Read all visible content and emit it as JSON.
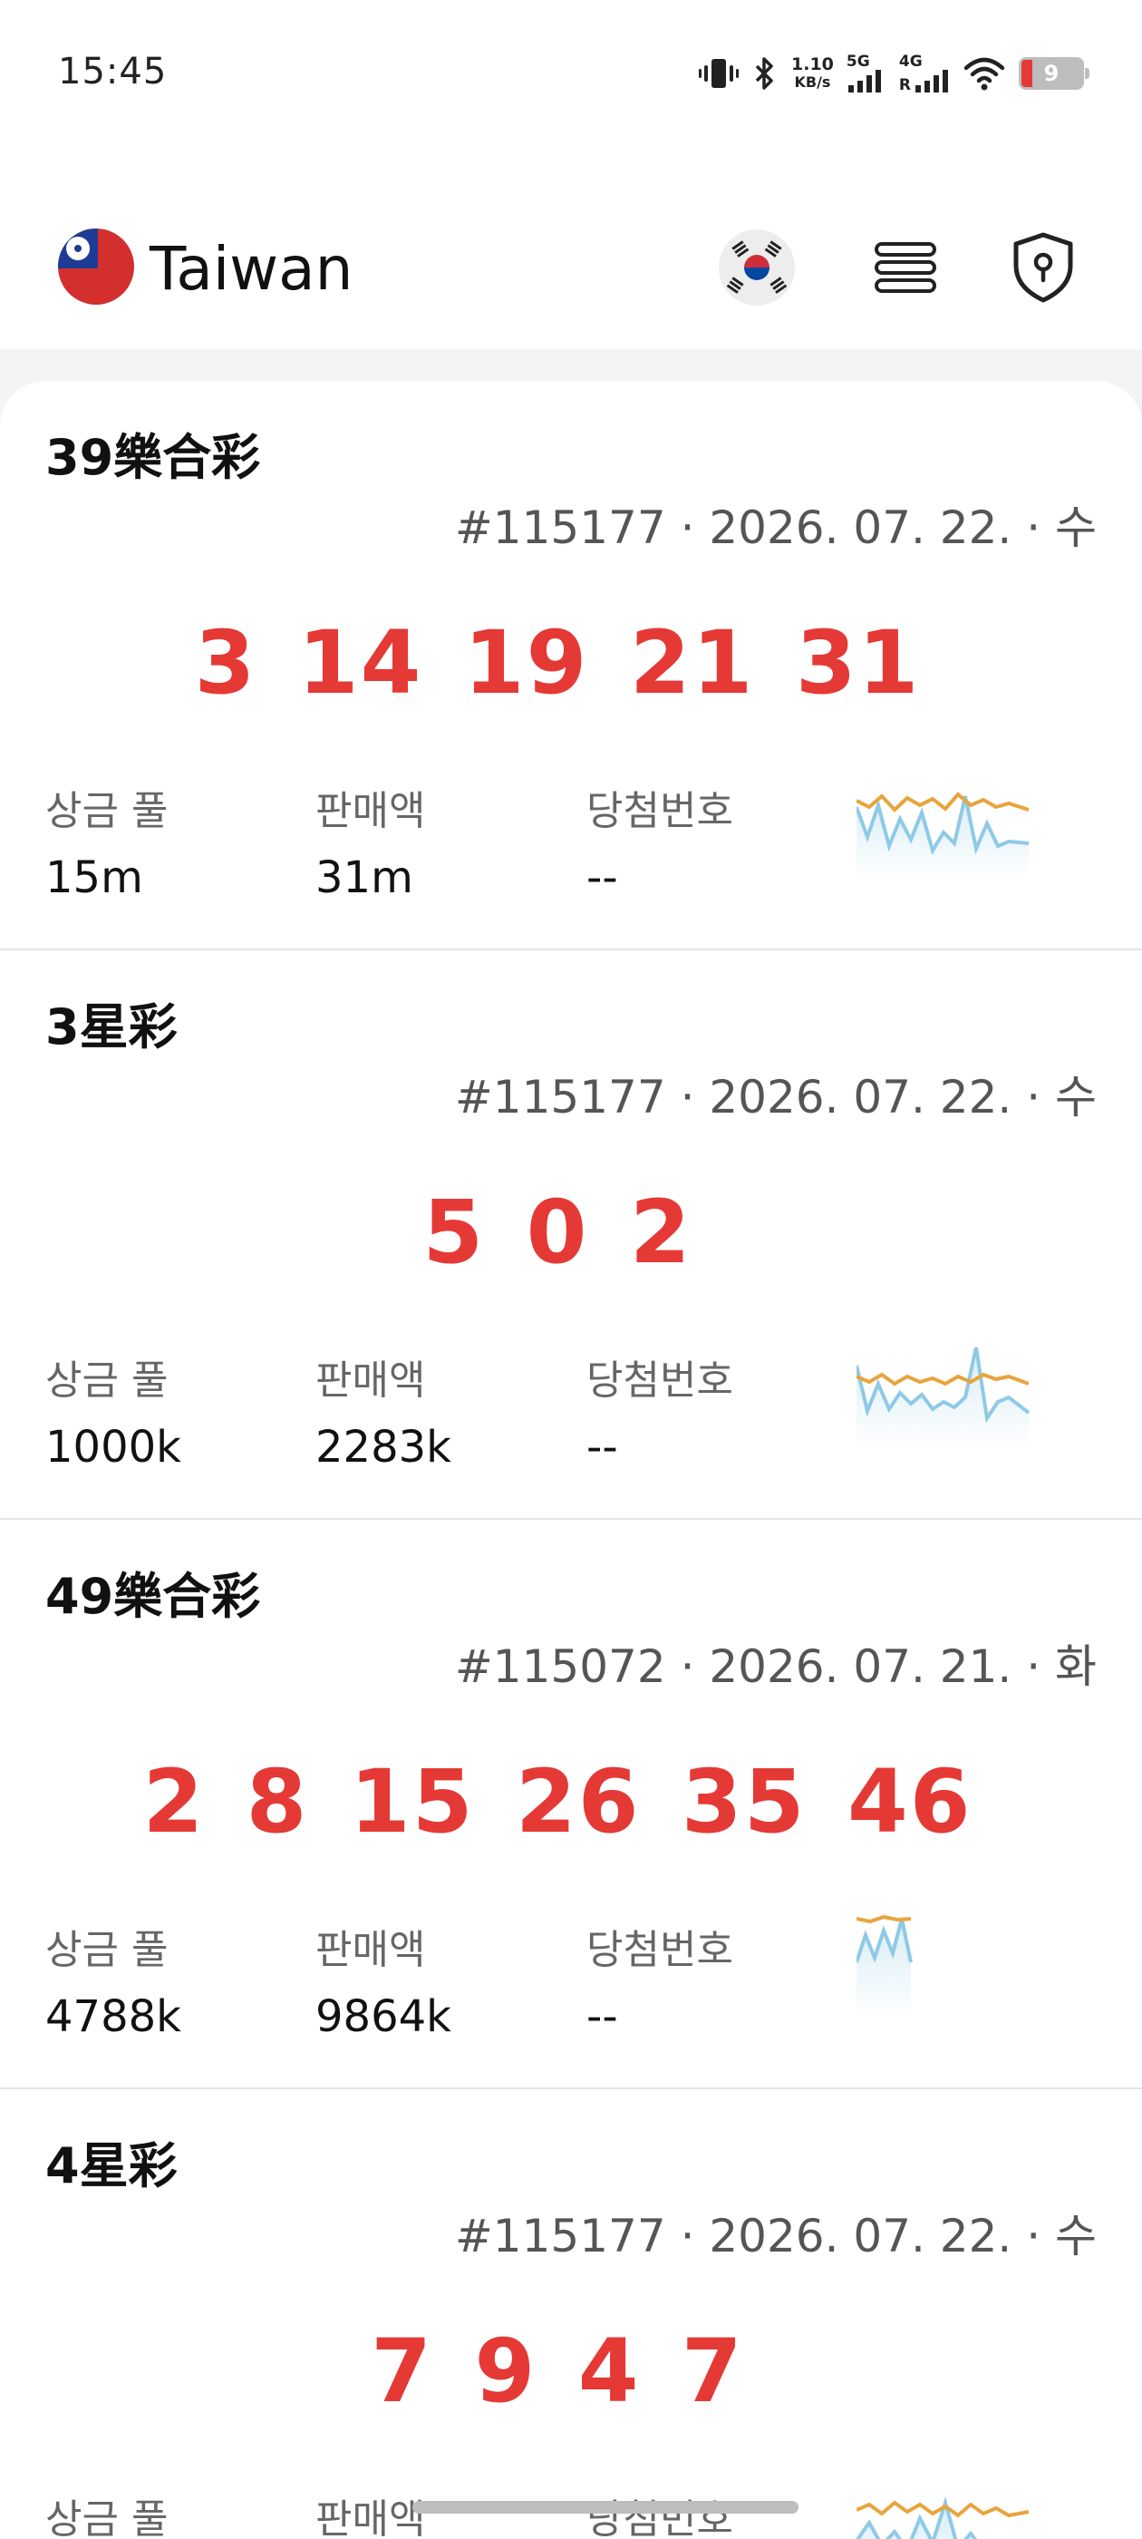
{
  "status_bar": {
    "time": "15:45",
    "net_speed_value": "1.10",
    "net_speed_unit": "KB/s",
    "sig1_label": "5G",
    "sig2_label": "4G",
    "sig2_sub": "R",
    "battery_level": "9",
    "icons": [
      "vibrate-icon",
      "bluetooth-icon",
      "signal-icon",
      "signal-icon",
      "wifi-icon",
      "battery-icon"
    ]
  },
  "header": {
    "title": "Taiwan",
    "country_flag_icon": "taiwan-flag-icon",
    "language_icon": "korea-flag-icon",
    "menu_icon": "menu-icon",
    "privacy_icon": "shield-lock-icon"
  },
  "lotteries": [
    {
      "name": "39樂合彩",
      "meta": "#115177 · 2026. 07. 22. · 수",
      "numbers": "3 14 19 21 31",
      "prize_label": "상금 풀",
      "prize_value": "15m",
      "sales_label": "판매액",
      "sales_value": "31m",
      "win_label": "당첨번호",
      "win_value": "--"
    },
    {
      "name": "3星彩",
      "meta": "#115177 · 2026. 07. 22. · 수",
      "numbers": "5 0 2",
      "prize_label": "상금 풀",
      "prize_value": "1000k",
      "sales_label": "판매액",
      "sales_value": "2283k",
      "win_label": "당첨번호",
      "win_value": "--"
    },
    {
      "name": "49樂合彩",
      "meta": "#115072 · 2026. 07. 21. · 화",
      "numbers": "2 8 15 26 35 46",
      "prize_label": "상금 풀",
      "prize_value": "4788k",
      "sales_label": "판매액",
      "sales_value": "9864k",
      "win_label": "당첨번호",
      "win_value": "--"
    },
    {
      "name": "4星彩",
      "meta": "#115177 · 2026. 07. 22. · 수",
      "numbers": "7 9 4 7",
      "prize_label": "상금 풀",
      "prize_value": "",
      "sales_label": "판매액",
      "sales_value": "",
      "win_label": "당첨번호",
      "win_value": ""
    }
  ],
  "colors": {
    "numbers_red": "#e53935",
    "spark_orange": "#e8a43c",
    "spark_blue": "#8ecae6"
  }
}
